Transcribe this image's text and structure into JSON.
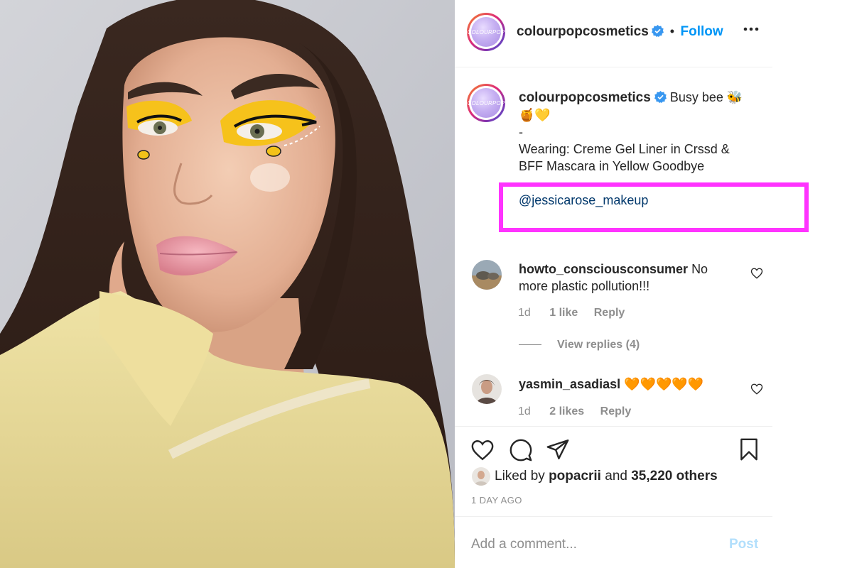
{
  "post": {
    "author": "colourpopcosmetics",
    "avatar_text": "COLOURPOP",
    "follow_label": "Follow",
    "separator": "•",
    "more_icon": "more-horizontal-icon",
    "verified_icon": "verified-badge-icon",
    "photo_description_icon": "photo"
  },
  "caption": {
    "author": "colourpopcosmetics",
    "line1": "Busy bee 🐝",
    "line2": "🍯💛",
    "line3": "-",
    "line4": "Wearing: Creme Gel Liner in Crssd &",
    "line5": "BFF Mascara in Yellow Goodbye",
    "mention": "@jessicarose_makeup"
  },
  "comments": [
    {
      "user": "howto_consciousconsumer",
      "text_a": "No",
      "text_b": "more plastic pollution!!!",
      "age": "1d",
      "likes": "1 like",
      "reply": "Reply",
      "view_replies": "View replies (4)"
    },
    {
      "user": "yasmin_asadiasl",
      "text_a": "🧡🧡🧡🧡🧡",
      "age": "1d",
      "likes": "2 likes",
      "reply": "Reply"
    }
  ],
  "engagement": {
    "liked_by_prefix": "Liked by",
    "liked_by_user": "popacrii",
    "liked_by_and": "and",
    "liked_by_others": "35,220 others",
    "timestamp": "1 DAY AGO"
  },
  "composer": {
    "placeholder": "Add a comment...",
    "post_label": "Post"
  },
  "colors": {
    "accent_blue": "#0095f6",
    "mention_blue": "#00376b",
    "highlight_magenta": "#ff33ff",
    "post_disabled": "#b2dffc"
  }
}
